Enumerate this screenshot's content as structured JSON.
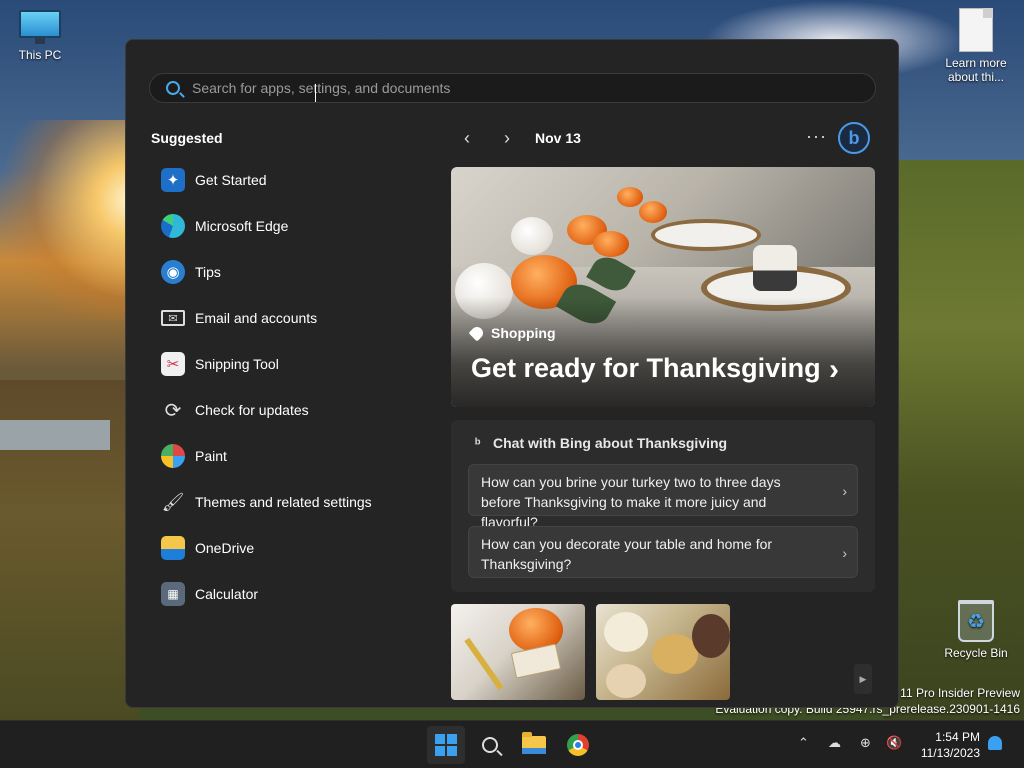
{
  "desktop": {
    "icons": [
      {
        "label": "This PC"
      },
      {
        "label": "Learn more about thi..."
      },
      {
        "label": "Recycle Bin"
      }
    ],
    "watermark": {
      "line1": "11 Pro Insider Preview",
      "line2": "Evaluation copy. Build 25947.rs_prerelease.230901-1416"
    }
  },
  "start_menu": {
    "search": {
      "placeholder": "Search for apps, settings, and documents",
      "value": ""
    },
    "suggested_heading": "Suggested",
    "apps": [
      {
        "label": "Get Started",
        "icon": "get-started-icon"
      },
      {
        "label": "Microsoft Edge",
        "icon": "edge-icon"
      },
      {
        "label": "Tips",
        "icon": "tips-icon"
      },
      {
        "label": "Email and accounts",
        "icon": "mail-icon"
      },
      {
        "label": "Snipping Tool",
        "icon": "snipping-tool-icon"
      },
      {
        "label": "Check for updates",
        "icon": "refresh-icon"
      },
      {
        "label": "Paint",
        "icon": "paint-icon"
      },
      {
        "label": "Themes and related settings",
        "icon": "brush-icon"
      },
      {
        "label": "OneDrive",
        "icon": "onedrive-icon"
      },
      {
        "label": "Calculator",
        "icon": "calculator-icon"
      }
    ],
    "feed": {
      "date": "Nov 13",
      "more_label": "···",
      "bing_label": "b",
      "hero": {
        "tag": "Shopping",
        "headline": "Get ready for Thanksgiving"
      },
      "chat": {
        "heading": "Chat with Bing about Thanksgiving",
        "questions": [
          "How can you brine your turkey two to three days before Thanksgiving to make it more juicy and flavorful?",
          "How can you decorate your table and home for Thanksgiving?"
        ]
      }
    }
  },
  "taskbar": {
    "time": "1:54 PM",
    "date": "11/13/2023",
    "accent": "#3aa0f0"
  }
}
